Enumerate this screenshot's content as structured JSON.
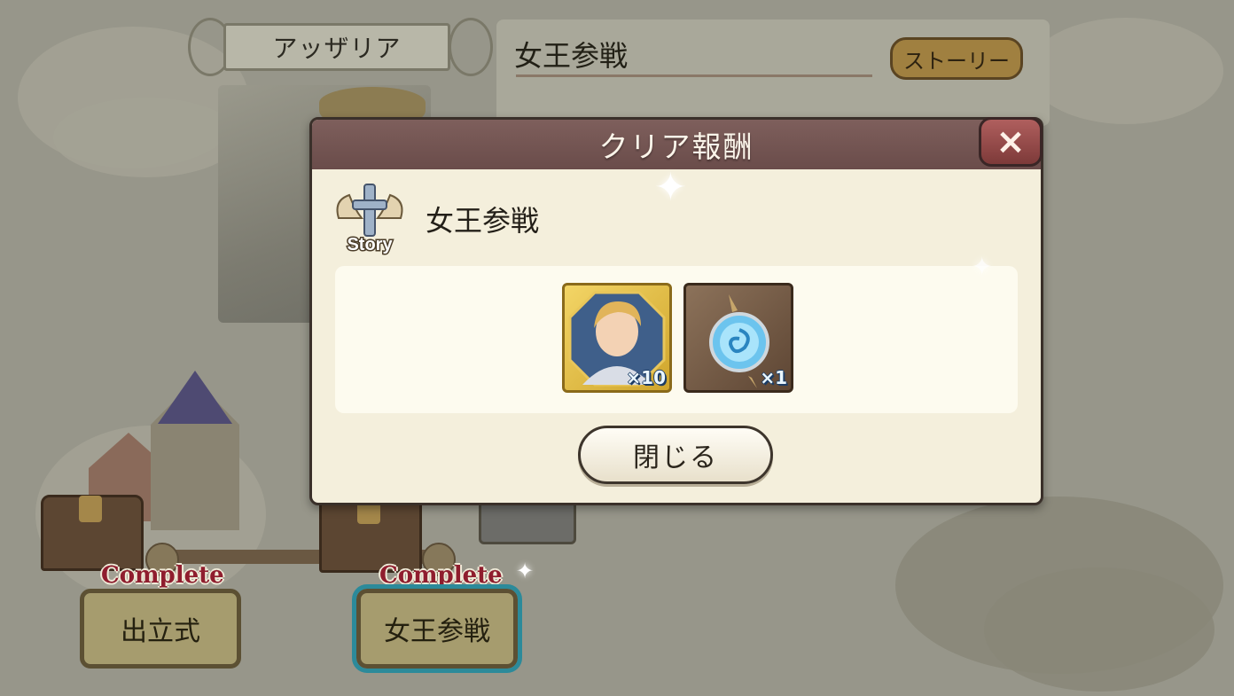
{
  "scene": {
    "chapter_name": "アッザリア",
    "info_panel_title": "女王参戦",
    "story_button_label": "ストーリー",
    "stages": [
      {
        "complete_label": "Complete",
        "name": "出立式",
        "selected": false
      },
      {
        "complete_label": "Complete",
        "name": "女王参戦",
        "selected": true
      }
    ]
  },
  "dialog": {
    "header": "クリア報酬",
    "close_icon": "×",
    "story_badge": "Story",
    "title": "女王参戦",
    "rewards": [
      {
        "icon": "character-portrait-icon",
        "quantity": "×10",
        "frame_color": "#e2bb47"
      },
      {
        "icon": "blue-orb-icon",
        "quantity": "×1",
        "frame_color": "#6e5442"
      }
    ],
    "close_button_label": "閉じる"
  },
  "colors": {
    "dialog_header": "#735552",
    "close_button": "#9a4d4c",
    "complete_text": "#8f1d2e",
    "selected_outline": "#2c8a9a"
  }
}
